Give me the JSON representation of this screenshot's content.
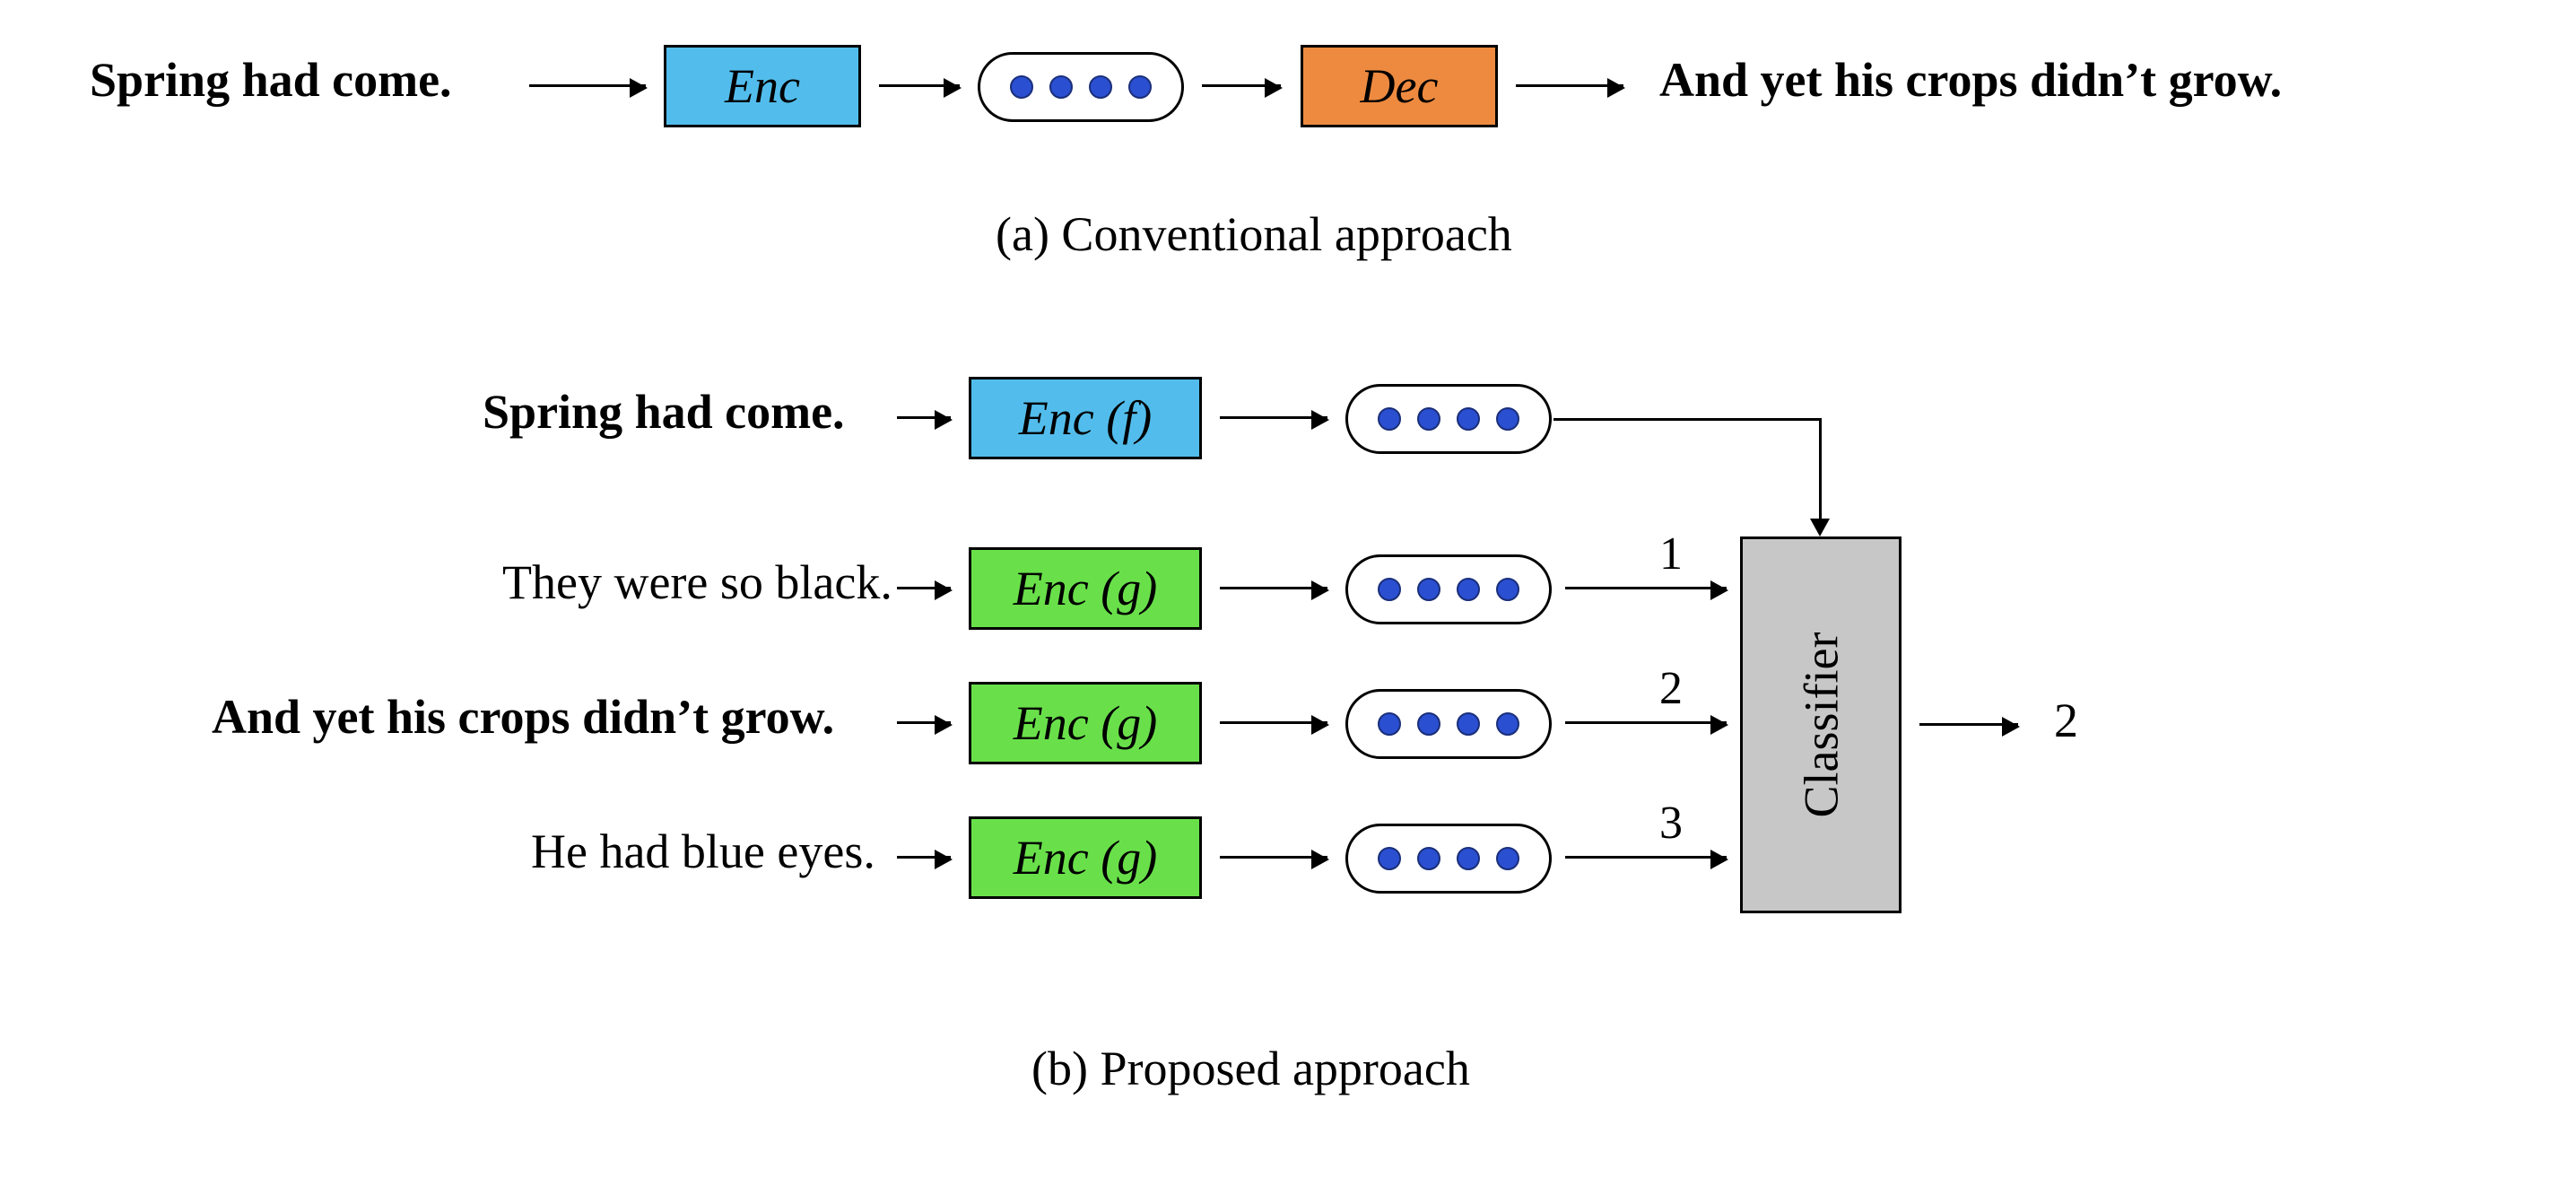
{
  "partA": {
    "input_text": "Spring had come.",
    "encoder_label": "Enc",
    "decoder_label": "Dec",
    "output_text": "And yet his crops didn’t grow.",
    "caption": "(a) Conventional approach"
  },
  "partB": {
    "input_text": "Spring had come.",
    "encoder_f_label": "Enc (f)",
    "candidates": [
      {
        "text": "They were so black.",
        "bold": false,
        "encoder_label": "Enc (g)",
        "index_label": "1"
      },
      {
        "text": "And yet his crops didn’t grow.",
        "bold": true,
        "encoder_label": "Enc (g)",
        "index_label": "2"
      },
      {
        "text": "He had blue eyes.",
        "bold": false,
        "encoder_label": "Enc (g)",
        "index_label": "3"
      }
    ],
    "classifier_label": "Classifier",
    "output_label": "2",
    "caption": "(b) Proposed approach"
  },
  "colors": {
    "encoder_blue": "#52bdec",
    "decoder_orange": "#ed8a3f",
    "encoder_green": "#69e04a",
    "classifier_gray": "#c7c7c7",
    "embedding_dot": "#2b4fd1"
  }
}
